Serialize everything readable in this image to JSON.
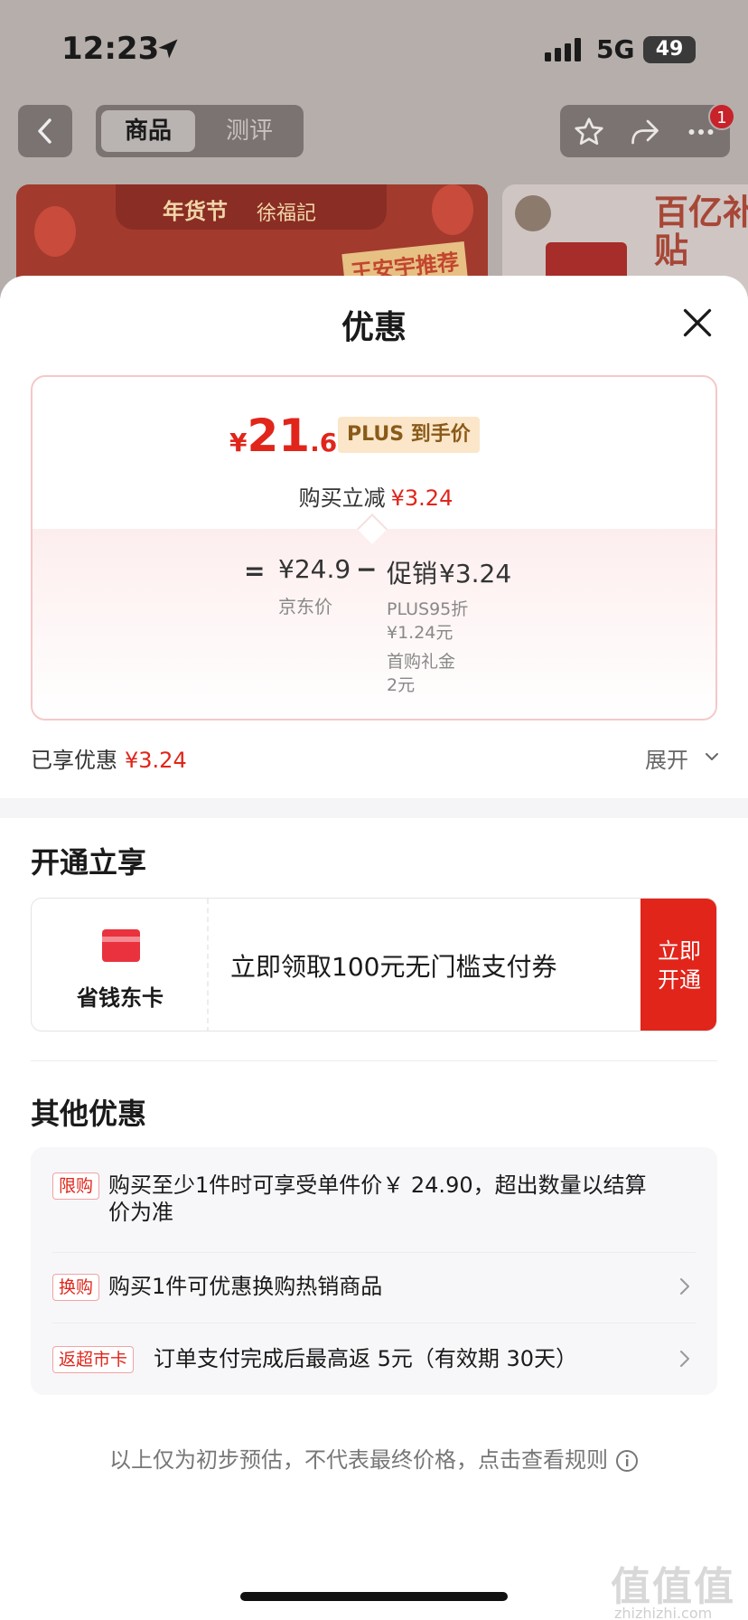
{
  "status_bar": {
    "time": "12:23",
    "network": "5G",
    "battery": "49"
  },
  "nav": {
    "tabs": [
      "商品",
      "测评"
    ],
    "active_tab": "商品",
    "badge_count": "1"
  },
  "banner": {
    "text1": "年货节",
    "text2": "徐福記",
    "text3": "王安宇推荐"
  },
  "banner2": {
    "text": "百亿补贴"
  },
  "sheet": {
    "title": "优惠",
    "final_price": {
      "symbol": "¥",
      "int": "21",
      "dec": ".66"
    },
    "plus_tag": "PLUS 到手价",
    "reduce_label": "购买立减",
    "reduce_amount": "¥3.24",
    "calc": {
      "equals": "=",
      "base_price": "¥24.9",
      "minus": "−",
      "promo_label": "促销",
      "promo_amount": "¥3.24",
      "base_label": "京东价",
      "detail1_line1": "PLUS95折",
      "detail1_line2": "¥1.24元",
      "detail2_line1": "首购礼金",
      "detail2_line2": "2元"
    },
    "enjoyed_label": "已享优惠",
    "enjoyed_amount": "¥3.24",
    "expand_label": "展开"
  },
  "open_section": {
    "title": "开通立享",
    "card_name": "省钱东卡",
    "description": "立即领取100元无门槛支付券",
    "button_line1": "立即",
    "button_line2": "开通"
  },
  "other_section": {
    "title": "其他优惠",
    "items": [
      {
        "tag": "限购",
        "line1": "购买至少1件时可享受单件价￥ 24.90，超出数量以结算",
        "line2": "价为准"
      },
      {
        "tag": "换购",
        "line1": "购买1件可优惠换购热销商品"
      },
      {
        "tag": "返超市卡",
        "line1": "订单支付完成后最高返 5元（有效期 30天）"
      }
    ]
  },
  "footnote": "以上仅为初步预估，不代表最终价格，点击查看规则",
  "watermark": {
    "main": "值值值",
    "sub": "zhizhizhi.com"
  },
  "colors": {
    "accent": "#e1251b",
    "plus_bg": "#fbe6c9",
    "plus_text": "#8a5a18"
  },
  "icons": [
    "location-arrow-icon",
    "signal-icon",
    "back-icon",
    "star-icon",
    "share-icon",
    "more-icon",
    "close-icon",
    "chevron-down-icon",
    "card-icon",
    "chevron-right-icon",
    "info-icon"
  ]
}
